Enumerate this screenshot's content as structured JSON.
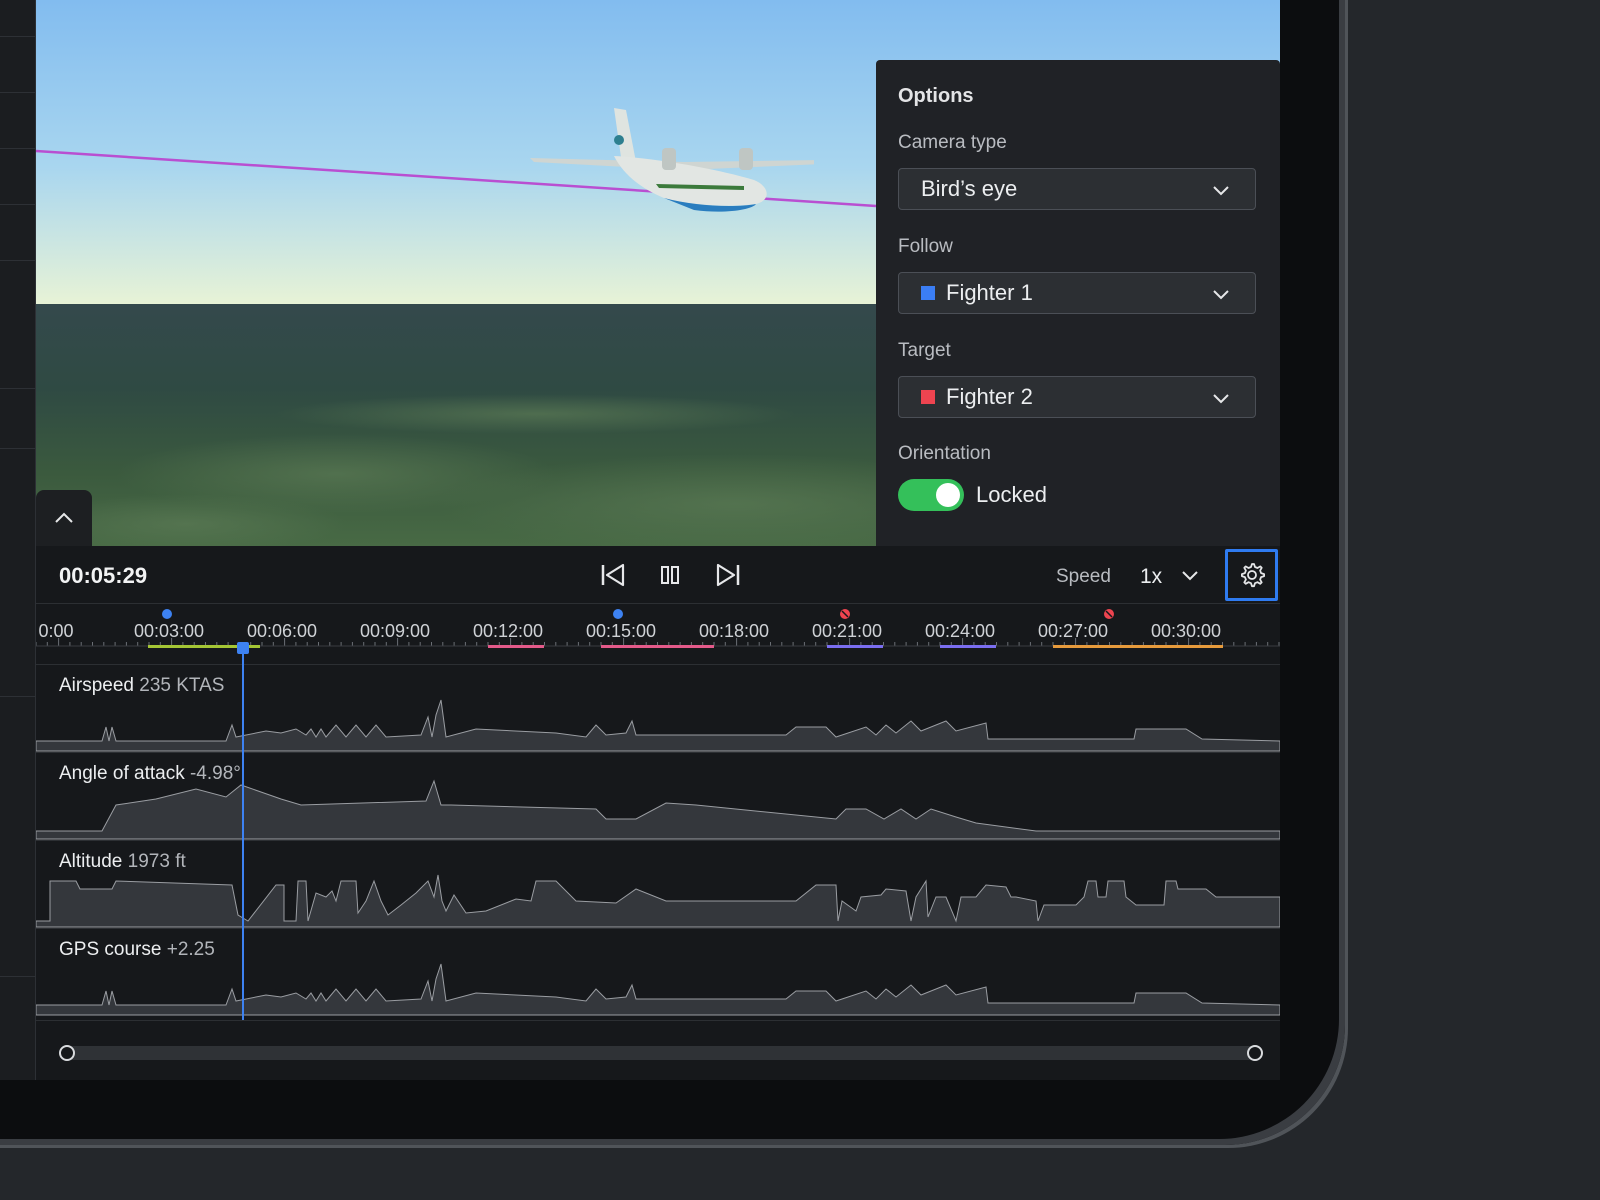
{
  "options": {
    "title": "Options",
    "camera_type_label": "Camera type",
    "camera_type_value": "Bird’s eye",
    "follow_label": "Follow",
    "follow_value": "Fighter 1",
    "follow_color": "#3b7ef4",
    "target_label": "Target",
    "target_value": "Fighter 2",
    "target_color": "#ee4450",
    "orientation_label": "Orientation",
    "orientation_value": "Locked",
    "orientation_on": true
  },
  "playback": {
    "time": "00:05:29",
    "speed_label": "Speed",
    "speed_value": "1x"
  },
  "timeline": {
    "ticks": [
      "0:00",
      "00:03:00",
      "00:06:00",
      "00:09:00",
      "00:12:00",
      "00:15:00",
      "00:18:00",
      "00:21:00",
      "00:24:00",
      "00:27:00",
      "00:30:00"
    ]
  },
  "graphs": [
    {
      "label": "Airspeed",
      "value": "235 KTAS"
    },
    {
      "label": "Angle of attack",
      "value": "-4.98°"
    },
    {
      "label": "Altitude",
      "value": "1973 ft"
    },
    {
      "label": "GPS course",
      "value": "+2.25"
    }
  ],
  "colors": {
    "accent": "#3d82f2",
    "toggle_on": "#34c05a",
    "flight_path": "#b94fd1"
  },
  "icons": [
    "chevron-up-icon",
    "chevron-down-icon",
    "skip-back-icon",
    "pause-icon",
    "skip-forward-icon",
    "gear-icon"
  ]
}
